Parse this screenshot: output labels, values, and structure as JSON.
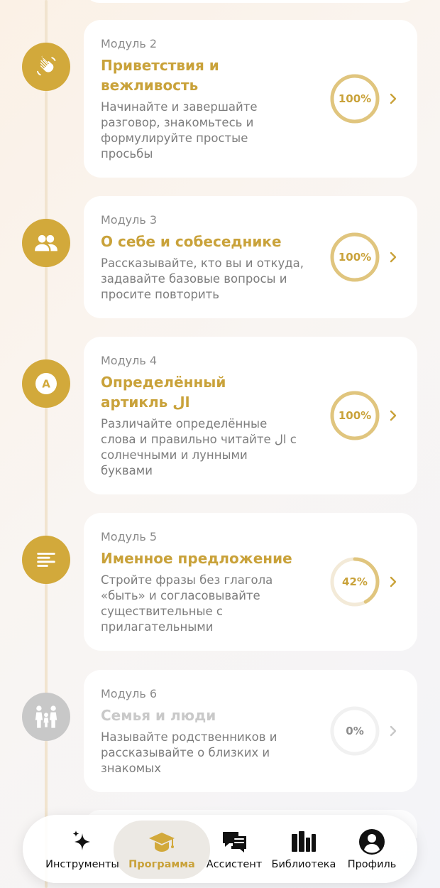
{
  "modules": [
    {
      "label": "Модуль 2",
      "title": "Приветствия и вежливость",
      "description": "Начинайте и завершайте разговор, знакомьтесь и формулируйте простые просьбы",
      "progress_text": "100%",
      "progress": 100,
      "icon": "waving-hand-icon",
      "locked": false
    },
    {
      "label": "Модуль 3",
      "title": "О себе и собеседнике",
      "description": "Рассказывайте, кто вы и откуда, задавайте базовые вопросы и просите повторить",
      "progress_text": "100%",
      "progress": 100,
      "icon": "people-icon",
      "locked": false
    },
    {
      "label": "Модуль 4",
      "title": "Определённый артикль ال",
      "description": "Различайте определённые слова и правильно читайте ال с солнечными и лунными буквами",
      "progress_text": "100%",
      "progress": 100,
      "icon": "letter-a-icon",
      "node_letter": "A",
      "locked": false
    },
    {
      "label": "Модуль 5",
      "title": "Именное предложение",
      "description": "Стройте фразы без глагола «быть» и согласовывайте существительные с прилагательными",
      "progress_text": "42%",
      "progress": 42,
      "icon": "text-lines-icon",
      "locked": false
    },
    {
      "label": "Модуль 6",
      "title": "Семья и люди",
      "description": "Называйте родственников и рассказывайте о близких и знакомых",
      "progress_text": "0%",
      "progress": 0,
      "icon": "family-icon",
      "locked": true
    }
  ],
  "nav": {
    "items": [
      {
        "label": "Инструменты",
        "icon": "sparkles-icon",
        "active": false
      },
      {
        "label": "Программа",
        "icon": "graduation-cap-icon",
        "active": true
      },
      {
        "label": "Ассистент",
        "icon": "chat-bubbles-icon",
        "active": false
      },
      {
        "label": "Библиотека",
        "icon": "books-icon",
        "active": false
      },
      {
        "label": "Профиль",
        "icon": "profile-icon",
        "active": false
      }
    ]
  },
  "colors": {
    "accent": "#c9a23a",
    "node": "#d2a93b",
    "locked": "#c8c8c8",
    "ring_track": "#f3ead8"
  }
}
